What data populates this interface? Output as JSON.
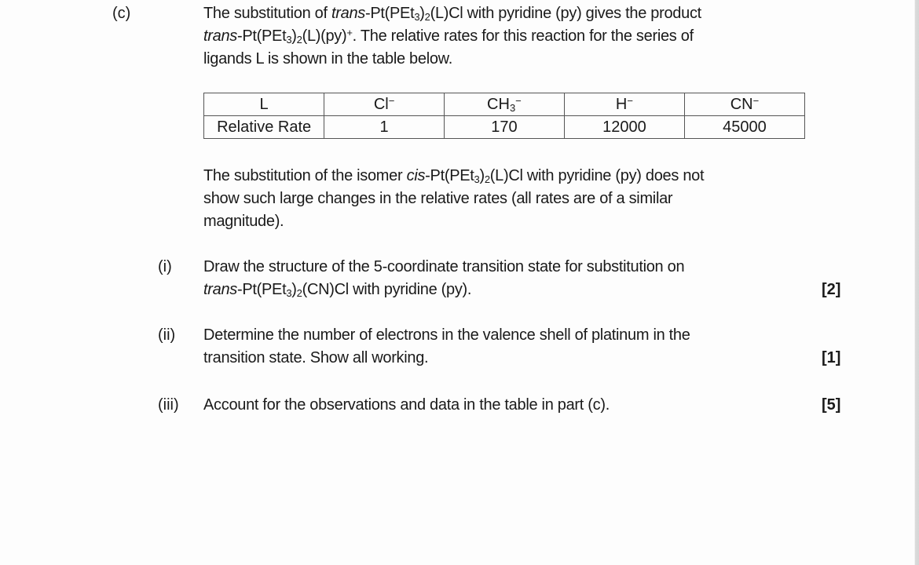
{
  "part": {
    "label": "(c)",
    "intro": {
      "l1_a": "The substitution of ",
      "l1_trans": "trans",
      "l1_b": "-Pt(PEt",
      "l1_c": "(L)Cl with pyridine (py) gives the product",
      "l2_trans": "trans",
      "l2_b": "-Pt(PEt",
      "l2_c": "(L)(py)",
      "l2_sup": "+",
      "l2_d": ". The relative rates for this reaction for the series of",
      "l3": "ligands L is shown in the table below.",
      "sub3": "3",
      "sub2": ")",
      "sub2n": "2"
    },
    "table": {
      "header": [
        "L",
        "Cl",
        "CH",
        "H",
        "CN"
      ],
      "header_sub": {
        "2": "3"
      },
      "header_sup": "−",
      "row_label": "Relative Rate",
      "values": [
        "1",
        "170",
        "12000",
        "45000"
      ]
    },
    "cis_note": {
      "l1_a": "The substitution of the isomer ",
      "l1_cis": "cis",
      "l1_b": "-Pt(PEt",
      "l1_c": "(L)Cl with pyridine (py) does not",
      "l2": "show such large changes in the relative rates (all rates are of a similar",
      "l3": "magnitude)."
    }
  },
  "questions": [
    {
      "label": "(i)",
      "l1": "Draw the structure of the 5-coordinate transition state for substitution on",
      "l2_trans": "trans",
      "l2_b": "-Pt(PEt",
      "l2_c": "(CN)Cl with pyridine (py).",
      "marks": "[2]"
    },
    {
      "label": "(ii)",
      "l1": "Determine the number of electrons in the valence shell of platinum in the",
      "l2": "transition state. Show all working.",
      "marks": "[1]"
    },
    {
      "label": "(iii)",
      "l1": "Account for the observations and data in the table in part (c).",
      "marks": "[5]"
    }
  ]
}
